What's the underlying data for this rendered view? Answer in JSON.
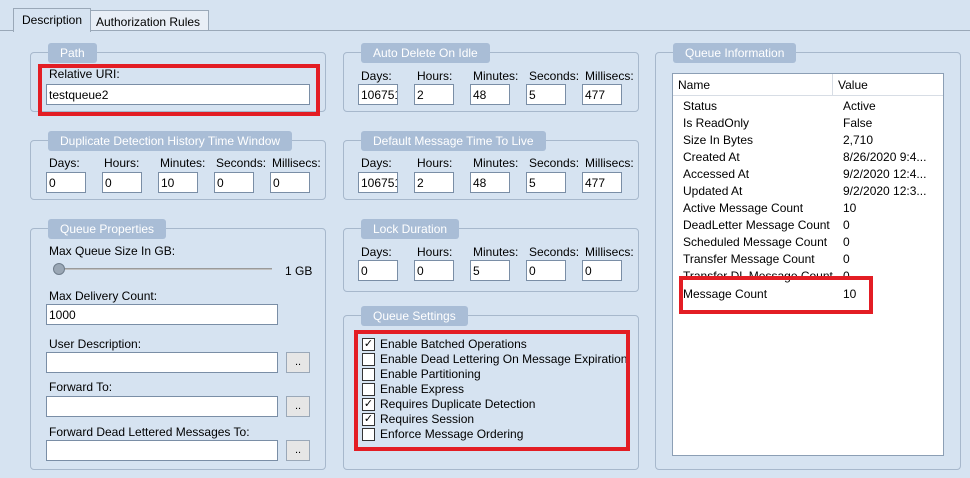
{
  "tabs": [
    {
      "label": "Description"
    },
    {
      "label": "Authorization Rules"
    }
  ],
  "path": {
    "legend": "Path",
    "uri_label": "Relative URI:",
    "uri_value": "testqueue2"
  },
  "duplicate_detection": {
    "legend": "Duplicate Detection History Time Window",
    "days_label": "Days:",
    "hours_label": "Hours:",
    "minutes_label": "Minutes:",
    "seconds_label": "Seconds:",
    "millisecs_label": "Millisecs:",
    "days": "0",
    "hours": "0",
    "minutes": "10",
    "seconds": "0",
    "millisecs": "0"
  },
  "queue_properties": {
    "legend": "Queue Properties",
    "max_size_label": "Max Queue Size In GB:",
    "max_size_value": "1 GB",
    "max_size_level": 0,
    "max_delivery_label": "Max Delivery Count:",
    "max_delivery_value": "1000",
    "user_description_label": "User Description:",
    "forward_to_label": "Forward To:",
    "forward_dead_label": "Forward Dead Lettered Messages To:",
    "browse_label": ".."
  },
  "auto_delete": {
    "legend": "Auto Delete On Idle",
    "days_label": "Days:",
    "hours_label": "Hours:",
    "minutes_label": "Minutes:",
    "seconds_label": "Seconds:",
    "millisecs_label": "Millisecs:",
    "days": "106751",
    "hours": "2",
    "minutes": "48",
    "seconds": "5",
    "millisecs": "477"
  },
  "default_ttl": {
    "legend": "Default Message Time To Live",
    "days_label": "Days:",
    "hours_label": "Hours:",
    "minutes_label": "Minutes:",
    "seconds_label": "Seconds:",
    "millisecs_label": "Millisecs:",
    "days": "106751",
    "hours": "2",
    "minutes": "48",
    "seconds": "5",
    "millisecs": "477"
  },
  "lock_duration": {
    "legend": "Lock Duration",
    "days_label": "Days:",
    "hours_label": "Hours:",
    "minutes_label": "Minutes:",
    "seconds_label": "Seconds:",
    "millisecs_label": "Millisecs:",
    "days": "0",
    "hours": "0",
    "minutes": "5",
    "seconds": "0",
    "millisecs": "0"
  },
  "queue_settings": {
    "legend": "Queue Settings",
    "check_mark": "✓",
    "items": [
      {
        "label": "Enable Batched Operations",
        "checked": true
      },
      {
        "label": "Enable Dead Lettering On Message Expiration",
        "checked": false
      },
      {
        "label": "Enable Partitioning",
        "checked": false
      },
      {
        "label": "Enable Express",
        "checked": false
      },
      {
        "label": "Requires Duplicate Detection",
        "checked": true
      },
      {
        "label": "Requires Session",
        "checked": true
      },
      {
        "label": "Enforce Message Ordering",
        "checked": false
      }
    ]
  },
  "queue_info": {
    "legend": "Queue Information",
    "col_name": "Name",
    "col_value": "Value",
    "rows": [
      {
        "name": "Status",
        "value": "Active"
      },
      {
        "name": "Is ReadOnly",
        "value": "False"
      },
      {
        "name": "Size In Bytes",
        "value": "2,710"
      },
      {
        "name": "Created At",
        "value": "8/26/2020 9:4..."
      },
      {
        "name": "Accessed At",
        "value": "9/2/2020 12:4..."
      },
      {
        "name": "Updated At",
        "value": "9/2/2020 12:3..."
      },
      {
        "name": "Active Message Count",
        "value": "10"
      },
      {
        "name": "DeadLetter Message Count",
        "value": "0"
      },
      {
        "name": "Scheduled Message Count",
        "value": "0"
      },
      {
        "name": "Transfer Message Count",
        "value": "0"
      },
      {
        "name": "Transfer DL Message Count",
        "value": "0"
      },
      {
        "name": "Message Count",
        "value": "10"
      }
    ]
  },
  "colors": {
    "background": "#d6e3f1",
    "legend": "#a9bdd6",
    "highlight": "#e31d24"
  }
}
